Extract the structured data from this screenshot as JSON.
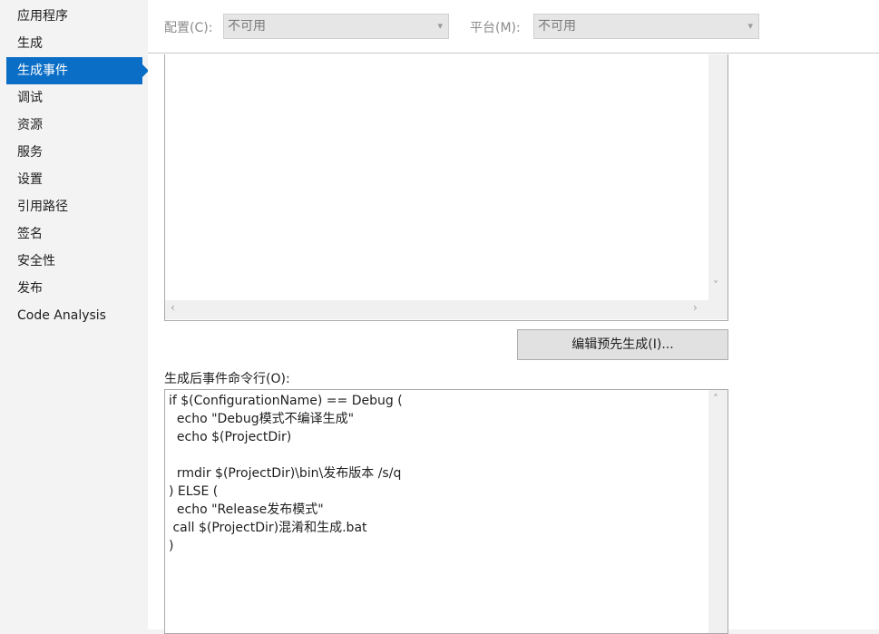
{
  "sidebar": {
    "items": [
      {
        "label": "应用程序"
      },
      {
        "label": "生成"
      },
      {
        "label": "生成事件"
      },
      {
        "label": "调试"
      },
      {
        "label": "资源"
      },
      {
        "label": "服务"
      },
      {
        "label": "设置"
      },
      {
        "label": "引用路径"
      },
      {
        "label": "签名"
      },
      {
        "label": "安全性"
      },
      {
        "label": "发布"
      },
      {
        "label": "Code Analysis"
      }
    ],
    "active_index": 2
  },
  "config": {
    "configuration_label": "配置(C):",
    "configuration_value": "不可用",
    "platform_label": "平台(M):",
    "platform_value": "不可用"
  },
  "prebuild": {
    "value": "",
    "edit_button": "编辑预先生成(I)..."
  },
  "postbuild": {
    "label": "生成后事件命令行(O):",
    "value": "if $(ConfigurationName) == Debug (\n  echo \"Debug模式不编译生成\"\n  echo $(ProjectDir)\n\n  rmdir $(ProjectDir)\\bin\\发布版本 /s/q\n) ELSE (\n  echo \"Release发布模式\"\n call $(ProjectDir)混淆和生成.bat\n)"
  },
  "icons": {
    "chevron_down": "▾",
    "arrow_left": "‹",
    "arrow_right": "›",
    "arrow_up": "˄",
    "arrow_down": "˅"
  }
}
